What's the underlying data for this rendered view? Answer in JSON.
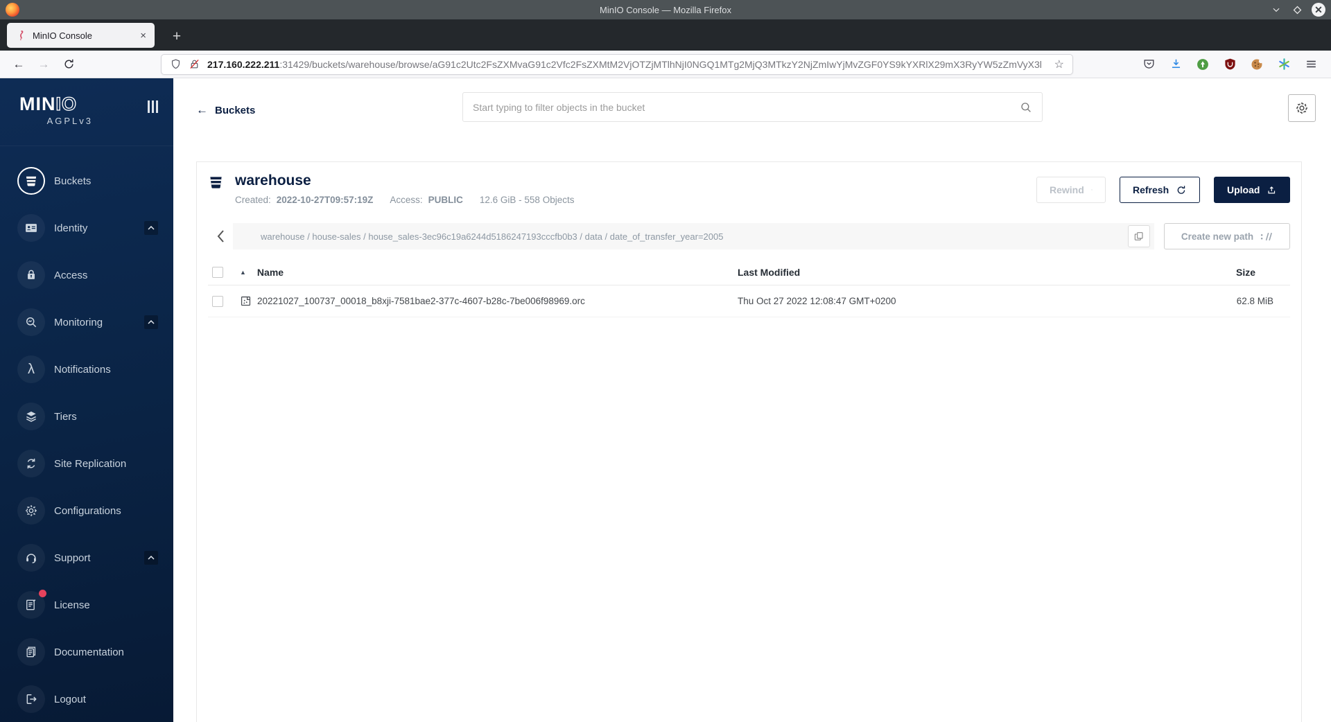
{
  "window": {
    "title": "MinIO Console — Mozilla Firefox"
  },
  "browser": {
    "tab": {
      "title": "MinIO Console"
    },
    "new_tab_glyph": "+",
    "close_tab_glyph": "×",
    "back_glyph": "←",
    "forward_glyph": "→",
    "bookmark_glyph": "☆",
    "url": {
      "host": "217.160.222.211",
      "rest": ":31429/buckets/warehouse/browse/aG91c2Utc2FsZXMvaG91c2Vfc2FsZXMtM2VjOTZjMTlhNjI0NGQ1MTg2MjQ3MTkzY2NjZmIwYjMvZGF0YS9kYXRlX29mX3RyYW5zZmVyX3l"
    }
  },
  "sidebar": {
    "logo": {
      "brand_bold": "MIN",
      "brand_light": "IO",
      "license": "AGPLv3"
    },
    "items": [
      {
        "label": "Buckets",
        "icon": "bucket-icon",
        "selected": true
      },
      {
        "label": "Identity",
        "icon": "identity-icon",
        "expandable": true
      },
      {
        "label": "Access",
        "icon": "access-icon"
      },
      {
        "label": "Monitoring",
        "icon": "monitoring-icon",
        "expandable": true
      },
      {
        "label": "Notifications",
        "icon": "lambda-icon",
        "glyph": "λ"
      },
      {
        "label": "Tiers",
        "icon": "tiers-icon"
      },
      {
        "label": "Site Replication",
        "icon": "replication-icon"
      },
      {
        "label": "Configurations",
        "icon": "gear-icon"
      },
      {
        "label": "Support",
        "icon": "support-icon",
        "expandable": true
      },
      {
        "label": "License",
        "icon": "license-icon",
        "badge": true
      },
      {
        "label": "Documentation",
        "icon": "documentation-icon"
      },
      {
        "label": "Logout",
        "icon": "logout-icon"
      }
    ]
  },
  "header": {
    "back_arrow": "←",
    "back_label": "Buckets",
    "search_placeholder": "Start typing to filter objects in the bucket"
  },
  "bucket": {
    "name": "warehouse",
    "created_label": "Created:",
    "created": "2022-10-27T09:57:19Z",
    "access_label": "Access:",
    "access": "PUBLIC",
    "usage": "12.6 GiB - 558 Objects",
    "rewind_label": "Rewind",
    "refresh_label": "Refresh",
    "upload_label": "Upload"
  },
  "browse": {
    "breadcrumb": "warehouse / house-sales / house_sales-3ec96c19a6244d5186247193cccfb0b3 / data / date_of_transfer_year=2005",
    "create_path_label": "Create new path"
  },
  "table": {
    "sort_glyph": "▲",
    "columns": {
      "name": "Name",
      "modified": "Last Modified",
      "size": "Size"
    },
    "rows": [
      {
        "name": "20221027_100737_00018_b8xji-7581bae2-377c-4607-b28c-7be006f98969.orc",
        "modified": "Thu Oct 27 2022 12:08:47 GMT+0200",
        "size": "62.8 MiB"
      }
    ]
  },
  "colors": {
    "accent_navy": "#0b1f42",
    "sidebar_top": "#0e2c55",
    "sidebar_bottom": "#071a35",
    "badge_red": "#e5425c",
    "titlebar_gray": "#4d5356",
    "tabstrip_dark": "#24282c",
    "muted_text": "#8a949e"
  }
}
